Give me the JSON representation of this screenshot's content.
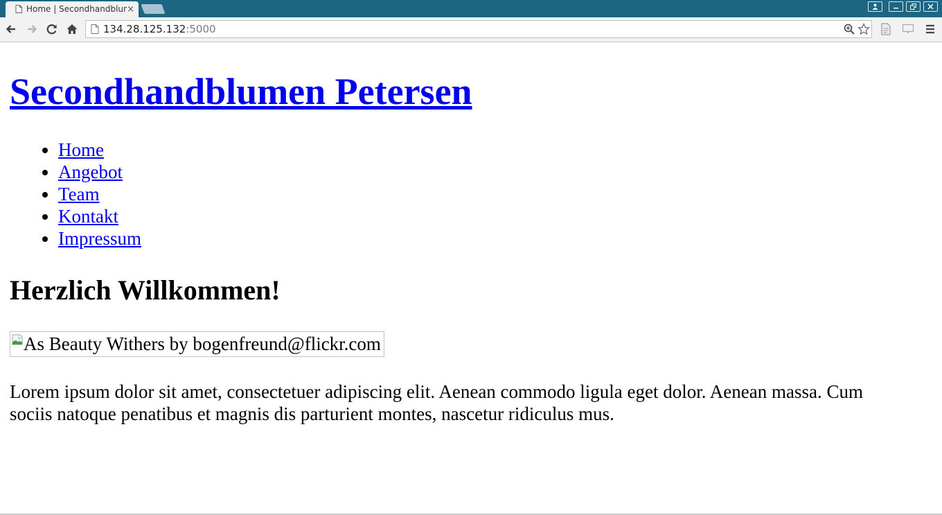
{
  "browser": {
    "tab_title": "Home | Secondhandblumen Petersen",
    "tab_close": "×",
    "url_host": "134.28.125.132",
    "url_port": ":5000"
  },
  "site": {
    "title": "Secondhandblumen Petersen",
    "nav": [
      "Home",
      "Angebot",
      "Team",
      "Kontakt",
      "Impressum"
    ],
    "heading": "Herzlich Willkommen!",
    "image_alt": "As Beauty Withers by bogenfreund@flickr.com",
    "paragraph": "Lorem ipsum dolor sit amet, consectetuer adipiscing elit. Aenean commodo ligula eget dolor. Aenean massa. Cum sociis natoque penatibus et magnis dis parturient montes, nascetur ridiculus mus."
  },
  "colors": {
    "titlebar": "#1c6583",
    "link": "#0000ee",
    "toolbar": "#f2f2f2"
  }
}
